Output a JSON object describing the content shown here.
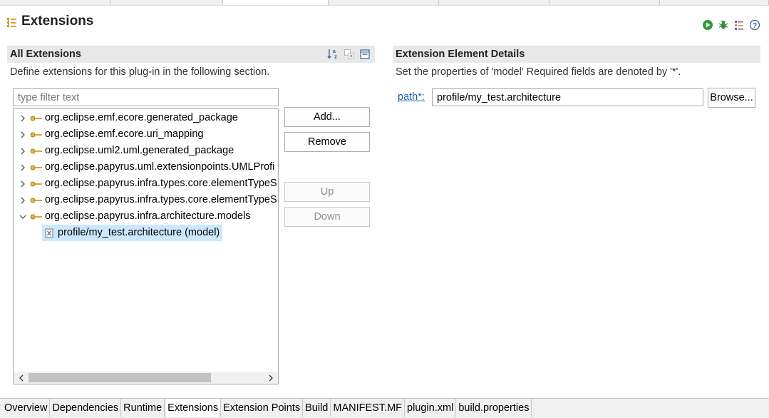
{
  "header": {
    "title": "Extensions"
  },
  "all_extensions": {
    "title": "All Extensions",
    "description": "Define extensions for this plug-in in the following section.",
    "filter_placeholder": "type filter text",
    "tree": [
      {
        "label": "org.eclipse.emf.ecore.generated_package",
        "expanded": false
      },
      {
        "label": "org.eclipse.emf.ecore.uri_mapping",
        "expanded": false
      },
      {
        "label": "org.eclipse.uml2.uml.generated_package",
        "expanded": false
      },
      {
        "label": "org.eclipse.papyrus.uml.extensionpoints.UMLProfi",
        "expanded": false
      },
      {
        "label": "org.eclipse.papyrus.infra.types.core.elementTypeS",
        "expanded": false
      },
      {
        "label": "org.eclipse.papyrus.infra.types.core.elementTypeS",
        "expanded": false
      },
      {
        "label": "org.eclipse.papyrus.infra.architecture.models",
        "expanded": true
      },
      {
        "label": "profile/my_test.architecture (model)",
        "child": true,
        "selected": true
      }
    ],
    "buttons": {
      "add": "Add...",
      "remove": "Remove",
      "up": "Up",
      "down": "Down"
    }
  },
  "details": {
    "title": "Extension Element Details",
    "description": "Set the properties of 'model' Required fields are denoted by '*'.",
    "path_label": "path*:",
    "path_value": "profile/my_test.architecture",
    "browse_label": "Browse..."
  },
  "bottom_tabs": [
    {
      "label": "Overview"
    },
    {
      "label": "Dependencies"
    },
    {
      "label": "Runtime"
    },
    {
      "label": "Extensions",
      "active": true
    },
    {
      "label": "Extension Points"
    },
    {
      "label": "Build"
    },
    {
      "label": "MANIFEST.MF"
    },
    {
      "label": "plugin.xml"
    },
    {
      "label": "build.properties"
    }
  ],
  "icons": {
    "header": "extensions-icon",
    "tools": [
      "run-icon",
      "debug-icon",
      "export-icon",
      "help-icon"
    ],
    "section_tools": [
      "sort-alphabetical-icon",
      "expand-all-icon",
      "collapse-all-icon"
    ],
    "extension_node": "extension-icon",
    "element_node": "element-icon"
  },
  "colors": {
    "selection": "#cce8ff",
    "link": "#1a5fb4",
    "section_bar": "#e8e8e8"
  }
}
